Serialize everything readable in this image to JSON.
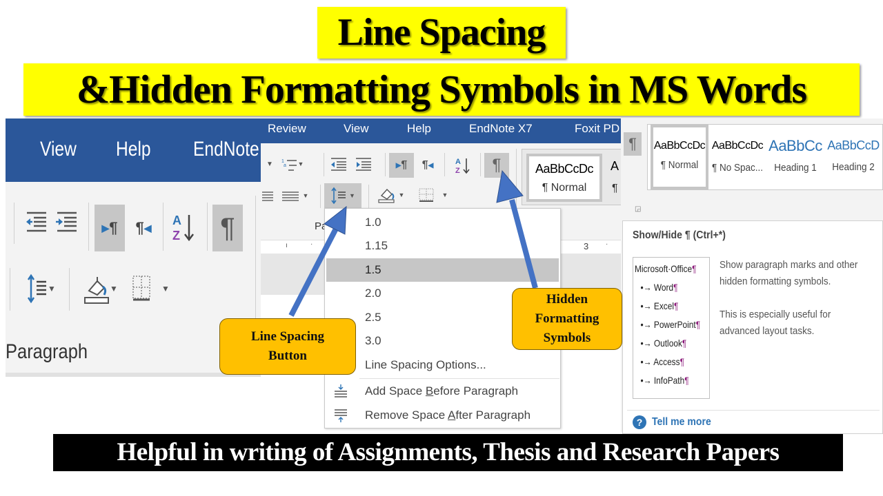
{
  "titles": {
    "line1": "Line Spacing",
    "line2": "&Hidden Formatting Symbols in MS Words"
  },
  "left_ribbon": {
    "tabs": [
      "View",
      "Help",
      "EndNote"
    ],
    "group_label": "Paragraph",
    "icons": {
      "decrease_indent": "decrease-indent-icon",
      "increase_indent": "increase-indent-icon",
      "ltr": "▸¶",
      "rtl": "¶◂",
      "sort": "A↓Z",
      "show_hide": "¶",
      "line_spacing": "line-spacing-icon",
      "shading": "shading-icon",
      "borders": "borders-icon"
    }
  },
  "mid_ribbon": {
    "tabs": [
      "Review",
      "View",
      "Help",
      "EndNote X7",
      "Foxit PD"
    ],
    "group_label_partial": "Pa",
    "ruler_mark": "3",
    "style_sample": "AaBbCcDc",
    "style_name": "¶ Normal",
    "show_hide": "¶"
  },
  "line_spacing_menu": {
    "options": [
      "1.0",
      "1.15",
      "1.5",
      "2.0",
      "2.5",
      "3.0"
    ],
    "selected": "1.5",
    "options_link": "Line Spacing Options...",
    "add_before": {
      "pre": "Add Space ",
      "key": "B",
      "post": "efore Paragraph"
    },
    "remove_after": {
      "pre": "Remove Space ",
      "key": "A",
      "post": "fter Paragraph"
    }
  },
  "styles_gallery": {
    "show_hide": "¶",
    "styles": [
      {
        "sample": "AaBbCcDc",
        "name": "¶ Normal"
      },
      {
        "sample": "AaBbCcDc",
        "name": "¶ No Spac..."
      },
      {
        "sample": "AaBbCc",
        "name": "Heading 1"
      },
      {
        "sample": "AaBbCcD",
        "name": "Heading 2"
      }
    ]
  },
  "tooltip": {
    "title": "Show/Hide ¶ (Ctrl+*)",
    "sample": {
      "header": "Microsoft·Office",
      "items": [
        "Word",
        "Excel",
        "PowerPoint",
        "Outlook",
        "Access",
        "InfoPath"
      ],
      "bullet": "•→ ",
      "mark": "¶"
    },
    "desc1": "Show paragraph marks and other hidden formatting symbols.",
    "desc2": "This is especially useful for advanced layout tasks.",
    "help_icon": "?",
    "help_link": "Tell me more"
  },
  "callouts": {
    "line_spacing": [
      "Line Spacing",
      "Button"
    ],
    "hidden": [
      "Hidden",
      "Formatting",
      "Symbols"
    ]
  },
  "footer": "Helpful in writing of Assignments, Thesis and Research Papers",
  "colors": {
    "title_bg": "#ffff00",
    "ribbon_blue": "#2b579a",
    "callout": "#ffc000",
    "arrow": "#4472c4",
    "heading_blue": "#2e74b5"
  }
}
